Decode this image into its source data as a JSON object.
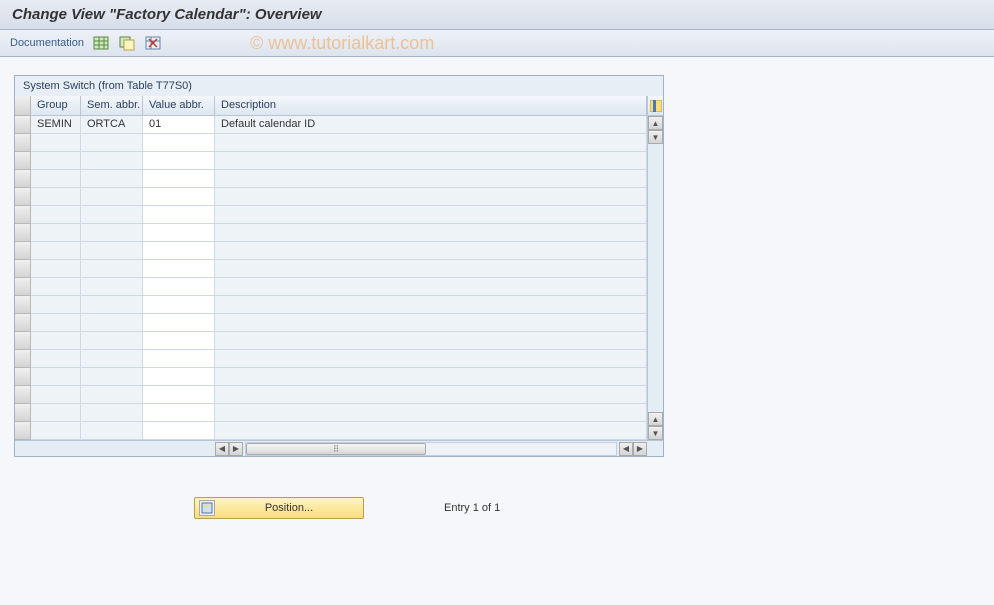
{
  "title": "Change View \"Factory Calendar\": Overview",
  "toolbar": {
    "documentation_label": "Documentation",
    "icons": [
      "table-icon",
      "copy-as-icon",
      "delete-selection-icon"
    ]
  },
  "watermark": "© www.tutorialkart.com",
  "panel": {
    "title": "System Switch (from Table T77S0)"
  },
  "columns": [
    {
      "key": "group",
      "label": "Group"
    },
    {
      "key": "sem",
      "label": "Sem. abbr."
    },
    {
      "key": "val",
      "label": "Value abbr."
    },
    {
      "key": "desc",
      "label": "Description"
    }
  ],
  "rows": [
    {
      "group": "SEMIN",
      "sem": "ORTCA",
      "val": "01",
      "desc": "Default calendar ID"
    }
  ],
  "empty_row_count": 17,
  "footer": {
    "position_label": "Position...",
    "entry_text": "Entry 1 of 1"
  }
}
